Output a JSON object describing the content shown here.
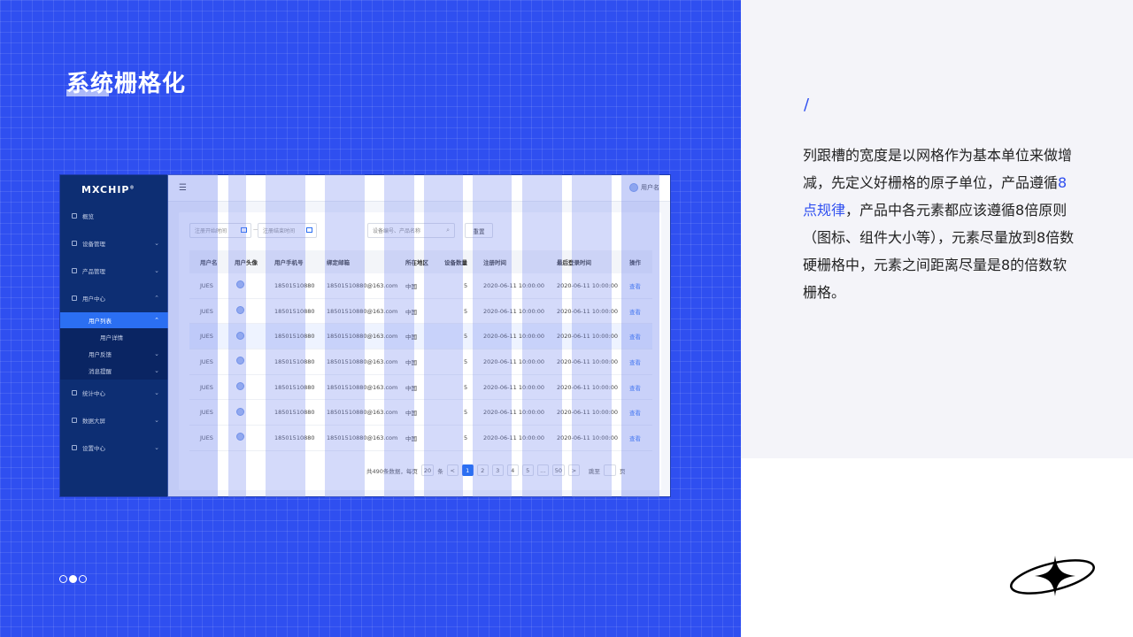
{
  "slide": {
    "title": "系统栅格化",
    "slash": "/",
    "description_parts": [
      "列跟槽的宽度是以网格作为基本单位来做增减，先定义好栅格的原子单位，产品遵循",
      "8点规律",
      "，产品中各元素都应该遵循8倍原则（图标、组件大小等），元素尽量放到8倍数硬栅格中，元素之间距离尽量是8的倍数软栅格。"
    ],
    "page_dots": 3,
    "current_dot": 2
  },
  "colors": {
    "brand_blue": "#2f4ff0",
    "sidebar": "#0d2e73",
    "active_nav": "#2b6ff2",
    "grid_overlay": "#788cf0"
  },
  "app": {
    "logo": "MXCHIP",
    "logo_mark": "®",
    "nav": [
      {
        "label": "概览",
        "icon": "overview-icon"
      },
      {
        "label": "设备管理",
        "icon": "device-icon"
      },
      {
        "label": "产品管理",
        "icon": "product-icon"
      },
      {
        "label": "用户中心",
        "icon": "user-icon"
      },
      {
        "label": "用户列表",
        "active": true
      },
      {
        "label": "用户详情"
      },
      {
        "label": "用户反馈"
      },
      {
        "label": "消息提醒"
      },
      {
        "label": "统计中心",
        "icon": "stats-icon"
      },
      {
        "label": "数据大屏",
        "icon": "screen-icon"
      },
      {
        "label": "设置中心",
        "icon": "settings-icon"
      }
    ],
    "topbar": {
      "menu_icon": "☰",
      "user_name": "用户名"
    },
    "filters": {
      "start_placeholder": "注册开始时间",
      "separator": "—",
      "end_placeholder": "注册结束时间",
      "search_placeholder": "设备编号、产品名称",
      "reset": "重置"
    },
    "table": {
      "headers": [
        "用户名",
        "用户头像",
        "用户手机号",
        "绑定邮箱",
        "所在地区",
        "设备数量",
        "注册时间",
        "最后登录时间",
        "操作"
      ],
      "rows": [
        {
          "name": "JUES",
          "phone": "18501510880",
          "email": "18501510880@163.com",
          "region": "中国",
          "devices": "5",
          "registered": "2020-06-11 10:00:00",
          "last_login": "2020-06-11 10:00:00",
          "action": "查看"
        },
        {
          "name": "JUES",
          "phone": "18501510880",
          "email": "18501510880@163.com",
          "region": "中国",
          "devices": "5",
          "registered": "2020-06-11 10:00:00",
          "last_login": "2020-06-11 10:00:00",
          "action": "查看"
        },
        {
          "name": "JUES",
          "phone": "18501510880",
          "email": "18501510880@163.com",
          "region": "中国",
          "devices": "5",
          "registered": "2020-06-11 10:00:00",
          "last_login": "2020-06-11 10:00:00",
          "action": "查看"
        },
        {
          "name": "JUES",
          "phone": "18501510880",
          "email": "18501510880@163.com",
          "region": "中国",
          "devices": "5",
          "registered": "2020-06-11 10:00:00",
          "last_login": "2020-06-11 10:00:00",
          "action": "查看"
        },
        {
          "name": "JUES",
          "phone": "18501510880",
          "email": "18501510880@163.com",
          "region": "中国",
          "devices": "5",
          "registered": "2020-06-11 10:00:00",
          "last_login": "2020-06-11 10:00:00",
          "action": "查看"
        },
        {
          "name": "JUES",
          "phone": "18501510880",
          "email": "18501510880@163.com",
          "region": "中国",
          "devices": "5",
          "registered": "2020-06-11 10:00:00",
          "last_login": "2020-06-11 10:00:00",
          "action": "查看"
        },
        {
          "name": "JUES",
          "phone": "18501510880",
          "email": "18501510880@163.com",
          "region": "中国",
          "devices": "5",
          "registered": "2020-06-11 10:00:00",
          "last_login": "2020-06-11 10:00:00",
          "action": "查看"
        }
      ]
    },
    "pagination": {
      "total_text": "共490条数据，每页",
      "page_size": "20",
      "unit": "条",
      "prev": "<",
      "pages": [
        "1",
        "2",
        "3",
        "4",
        "5",
        "...",
        "50"
      ],
      "current": "1",
      "next": ">",
      "goto_label": "跳至",
      "page_unit": "页"
    }
  }
}
